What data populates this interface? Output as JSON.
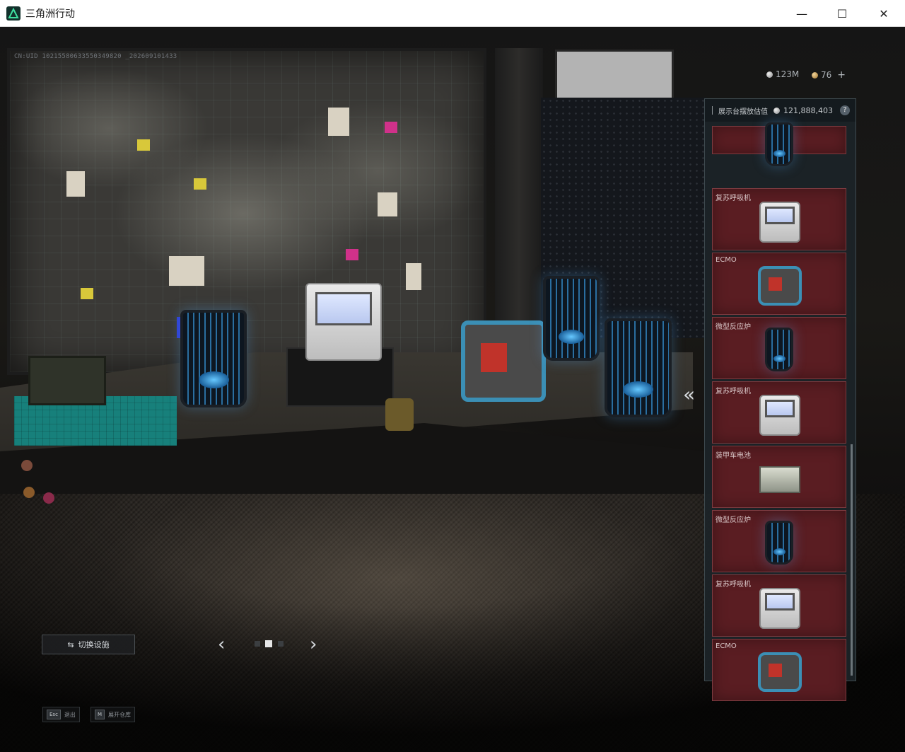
{
  "window": {
    "title": "三角洲行动",
    "minimize": "—",
    "maximize": "☐",
    "close": "✕"
  },
  "hud": {
    "uid": "CN:UID 10215580633550349820 _202609101433",
    "currency_1": "123M",
    "currency_2": "76",
    "add": "+"
  },
  "panel": {
    "title": "展示台摆放估值",
    "value": "121,888,403",
    "help": "?",
    "expand_arrow": "«",
    "slots": [
      {
        "label": "",
        "item": "reactor"
      },
      {
        "label": "复苏呼吸机",
        "item": "ventilator"
      },
      {
        "label": "ECMO",
        "item": "ecmo"
      },
      {
        "label": "微型反应炉",
        "item": "reactor"
      },
      {
        "label": "复苏呼吸机",
        "item": "ventilator"
      },
      {
        "label": "装甲车电池",
        "item": "battery"
      },
      {
        "label": "微型反应炉",
        "item": "reactor"
      },
      {
        "label": "复苏呼吸机",
        "item": "ventilator"
      },
      {
        "label": "ECMO",
        "item": "ecmo"
      }
    ]
  },
  "controls": {
    "switch_facility": "切换设施",
    "prev": "‹",
    "next": "›",
    "esc_key": "Esc",
    "esc_label": "退出",
    "m_key": "M",
    "m_label": "展开仓库"
  },
  "colors": {
    "slot_bg": "#5a1d22",
    "accent_blue": "#3b8fb5"
  }
}
